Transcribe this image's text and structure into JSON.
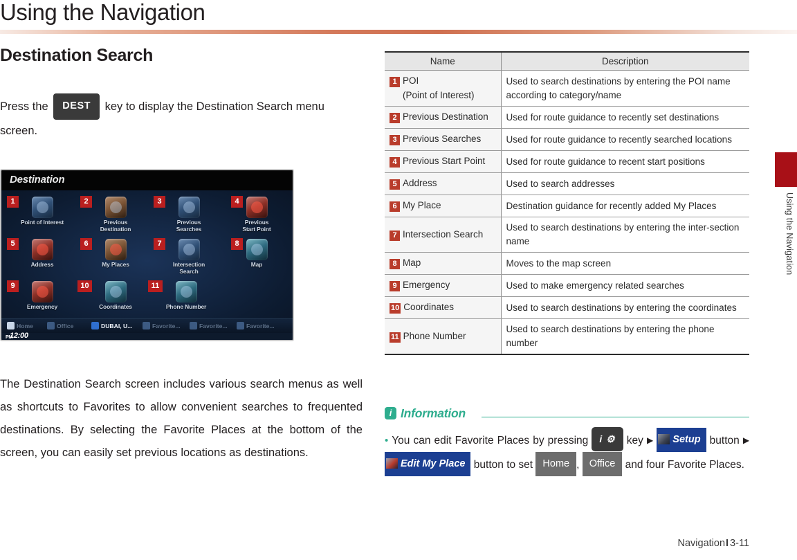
{
  "header": {
    "title": "Using the Navigation"
  },
  "side_tab": {
    "label": "Using the Navigation"
  },
  "left": {
    "section_title": "Destination Search",
    "intro_before": "Press the",
    "intro_key": "DEST",
    "intro_after": "key to display the Destination Search menu screen.",
    "body_paragraph": "The Destination Search screen includes various search menus as well as shortcuts to Favorites to allow convenient searches to frequented destinations. By selecting the  Favorite Places at the bottom of the screen, you can easily set previous locations as destinations."
  },
  "nav_screen": {
    "title": "Destination",
    "time": "12:00",
    "time_suffix": "PM",
    "items": [
      {
        "num": "1",
        "label": "Point of Interest"
      },
      {
        "num": "2",
        "label": "Previous\nDestination"
      },
      {
        "num": "3",
        "label": "Previous\nSearches"
      },
      {
        "num": "4",
        "label": "Previous\nStart Point"
      },
      {
        "num": "5",
        "label": "Address"
      },
      {
        "num": "6",
        "label": "My Places"
      },
      {
        "num": "7",
        "label": "Intersection\nSearch"
      },
      {
        "num": "8",
        "label": "Map"
      },
      {
        "num": "9",
        "label": "Emergency"
      },
      {
        "num": "10",
        "label": "Coordinates"
      },
      {
        "num": "11",
        "label": "Phone Number"
      }
    ],
    "favorites": [
      {
        "label": "Home",
        "state": "dim"
      },
      {
        "label": "Office",
        "state": "dim"
      },
      {
        "label": "DUBAI, U...",
        "state": "bright"
      },
      {
        "label": "Favorite...",
        "state": "dim"
      },
      {
        "label": "Favorite...",
        "state": "dim"
      },
      {
        "label": "Favorite...",
        "state": "dim"
      }
    ]
  },
  "table": {
    "headers": {
      "name": "Name",
      "description": "Description"
    },
    "rows": [
      {
        "num": "1",
        "name": "POI",
        "name_sub": "(Point of Interest)",
        "desc": "Used to search destinations by entering the POI name according to category/name"
      },
      {
        "num": "2",
        "name": "Previous Destination",
        "name_sub": "",
        "desc": "Used for route guidance to recently set destinations"
      },
      {
        "num": "3",
        "name": "Previous Searches",
        "name_sub": "",
        "desc": "Used for route guidance to recently searched locations"
      },
      {
        "num": "4",
        "name": "Previous Start Point",
        "name_sub": "",
        "desc": "Used for route guidance to recent start positions"
      },
      {
        "num": "5",
        "name": "Address",
        "name_sub": "",
        "desc": "Used to search addresses"
      },
      {
        "num": "6",
        "name": "My Place",
        "name_sub": "",
        "desc": "Destination guidance for recently added My Places"
      },
      {
        "num": "7",
        "name": "Intersection Search",
        "name_sub": "",
        "desc": "Used to search destinations by entering the inter-section name"
      },
      {
        "num": "8",
        "name": "Map",
        "name_sub": "",
        "desc": "Moves to the map screen"
      },
      {
        "num": "9",
        "name": "Emergency",
        "name_sub": "",
        "desc": "Used to make emergency related searches"
      },
      {
        "num": "10",
        "name": "Coordinates",
        "name_sub": "",
        "desc": "Used to search destinations by entering the coordinates"
      },
      {
        "num": "11",
        "name": "Phone Number",
        "name_sub": "",
        "desc": "Used to search destinations by entering the phone number"
      }
    ]
  },
  "information": {
    "icon_letter": "i",
    "title": "Information",
    "bullet_symbol": "•",
    "t1": "You can edit Favorite Places by pressing",
    "key_info_gear": "i ⚙",
    "t2": "key",
    "arrow": "▶",
    "btn_setup": "Setup",
    "t3": "button",
    "btn_edit_my_place": "Edit My Place",
    "t4": "button to set",
    "btn_home": "Home",
    "t5": ",",
    "btn_office": "Office",
    "t6": "and four Favorite Places."
  },
  "footer": {
    "label": "Navigation",
    "separator": "I",
    "page": "3-11"
  },
  "colors": {
    "accent_red": "#b93c2b",
    "tab_red": "#a81017",
    "info_teal": "#2ead8e",
    "rule_orange": "#cf6f4f",
    "button_blue": "#1c3f92",
    "button_gray": "#6d6d6d",
    "key_dark": "#3a3a3a"
  }
}
